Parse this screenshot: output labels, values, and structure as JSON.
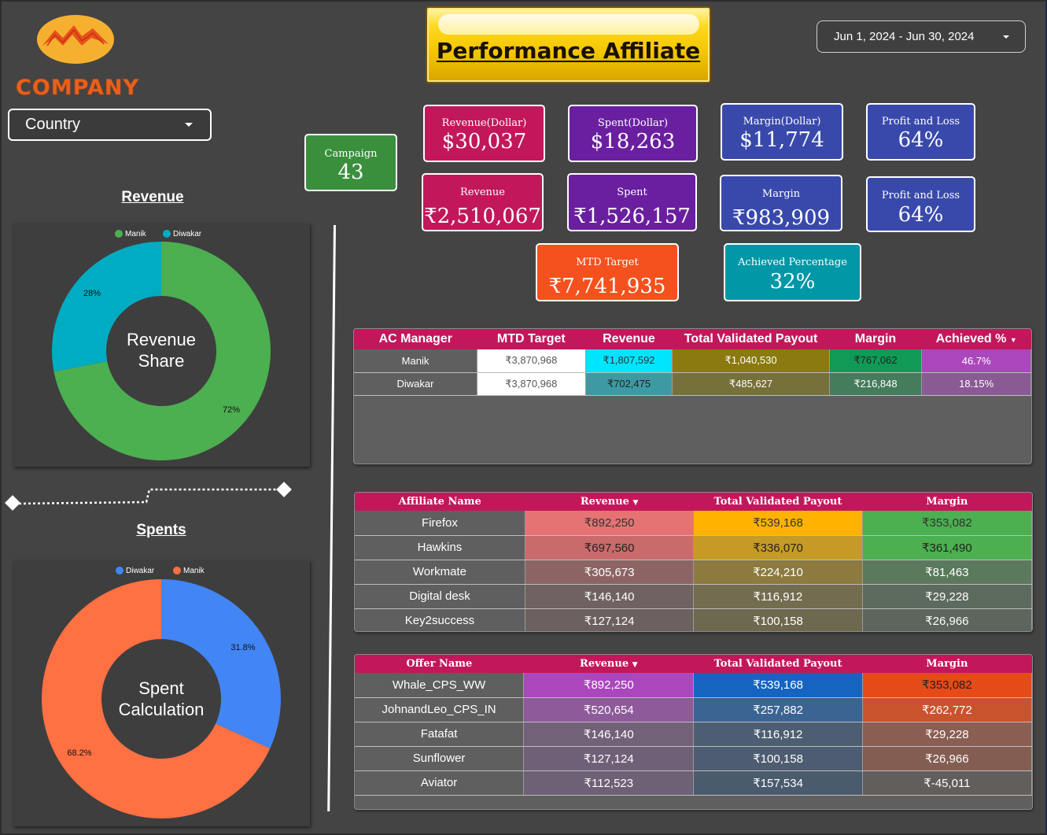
{
  "brand": {
    "name": "COMPANY"
  },
  "filters": {
    "country_label": "Country",
    "date_range": "Jun 1, 2024 - Jun 30, 2024"
  },
  "title": "Performance Affiliate",
  "campaign": {
    "label": "Campaign",
    "value": "43"
  },
  "kpis": {
    "revenue_usd": {
      "label": "Revenue(Dollar)",
      "value": "$30,037"
    },
    "spent_usd": {
      "label": "Spent(Dollar)",
      "value": "$18,263"
    },
    "margin_usd": {
      "label": "Margin(Dollar)",
      "value": "$11,774"
    },
    "pnl_1": {
      "label": "Profit and Loss",
      "value": "64%"
    },
    "revenue_inr": {
      "label": "Revenue",
      "value": "₹2,510,067"
    },
    "spent_inr": {
      "label": "Spent",
      "value": "₹1,526,157"
    },
    "margin_inr": {
      "label": "Margin",
      "value": "₹983,909"
    },
    "pnl_2": {
      "label": "Profit and Loss",
      "value": "64%"
    },
    "mtd_target": {
      "label": "MTD Target",
      "value": "₹7,741,935"
    },
    "achieved": {
      "label": "Achieved Percentage",
      "value": "32%"
    }
  },
  "revenue_chart": {
    "section_title": "Revenue",
    "center_text": [
      "Revenue",
      "Share"
    ],
    "legend": [
      "Manik",
      "Diwakar"
    ],
    "slices": [
      {
        "name": "Manik",
        "percent": 72,
        "label": "72%",
        "color": "#4caf50"
      },
      {
        "name": "Diwakar",
        "percent": 28,
        "label": "28%",
        "color": "#00acc1"
      }
    ]
  },
  "spent_chart": {
    "section_title": "Spents",
    "center_text": [
      "Spent",
      "Calculation"
    ],
    "legend": [
      "Diwakar",
      "Manik"
    ],
    "slices": [
      {
        "name": "Diwakar",
        "percent": 31.8,
        "label": "31.8%",
        "color": "#4285f4"
      },
      {
        "name": "Manik",
        "percent": 68.2,
        "label": "68.2%",
        "color": "#ff7043"
      }
    ]
  },
  "manager_table": {
    "headers": [
      "AC Manager",
      "MTD Target",
      "Revenue",
      "Total Validated Payout",
      "Margin",
      "Achieved %"
    ],
    "rows": [
      [
        "Manik",
        "₹3,870,968",
        "₹1,807,592",
        "₹1,040,530",
        "₹767,062",
        "46.7%"
      ],
      [
        "Diwakar",
        "₹3,870,968",
        "₹702,475",
        "₹485,627",
        "₹216,848",
        "18.15%"
      ]
    ]
  },
  "affiliate_table": {
    "headers": [
      "Affiliate Name",
      "Revenue",
      "Total Validated Payout",
      "Margin"
    ],
    "rows": [
      [
        "Firefox",
        "₹892,250",
        "₹539,168",
        "₹353,082"
      ],
      [
        "Hawkins",
        "₹697,560",
        "₹336,070",
        "₹361,490"
      ],
      [
        "Workmate",
        "₹305,673",
        "₹224,210",
        "₹81,463"
      ],
      [
        "Digital desk",
        "₹146,140",
        "₹116,912",
        "₹29,228"
      ],
      [
        "Key2success",
        "₹127,124",
        "₹100,158",
        "₹26,966"
      ]
    ]
  },
  "offer_table": {
    "headers": [
      "Offer Name",
      "Revenue",
      "Total Validated Payout",
      "Margin"
    ],
    "rows": [
      [
        "Whale_CPS_WW",
        "₹892,250",
        "₹539,168",
        "₹353,082"
      ],
      [
        "JohnandLeo_CPS_IN",
        "₹520,654",
        "₹257,882",
        "₹262,772"
      ],
      [
        "Fatafat",
        "₹146,140",
        "₹116,912",
        "₹29,228"
      ],
      [
        "Sunflower",
        "₹127,124",
        "₹100,158",
        "₹26,966"
      ],
      [
        "Aviator",
        "₹112,523",
        "₹157,534",
        "₹-45,011"
      ]
    ]
  }
}
